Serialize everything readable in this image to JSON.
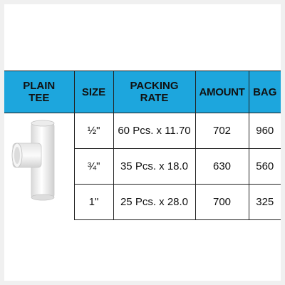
{
  "headers": {
    "product": [
      "PLAIN",
      "TEE"
    ],
    "size": "SIZE",
    "packing": [
      "PACKING",
      "RATE"
    ],
    "amount": "AMOUNT",
    "bag": "BAG"
  },
  "rows": [
    {
      "size": "½\"",
      "packing": "60 Pcs. x 11.70",
      "amount": "702",
      "bag": "960"
    },
    {
      "size": "¾\"",
      "packing": "35 Pcs. x 18.0",
      "amount": "630",
      "bag": "560"
    },
    {
      "size": "1\"",
      "packing": "25 Pcs. x 28.0",
      "amount": "700",
      "bag": "325"
    }
  ],
  "product_image": {
    "icon": "pvc-plain-tee-icon"
  },
  "colors": {
    "header_bg": "#1da6dd",
    "border": "#222222"
  }
}
